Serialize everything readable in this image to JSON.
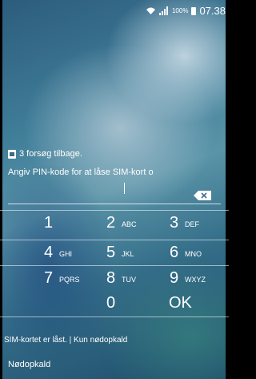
{
  "status_bar": {
    "battery": "100%",
    "time": "07.38",
    "icons": [
      "wifi-icon",
      "signal-icon",
      "battery-icon"
    ]
  },
  "pin_entry": {
    "attempts_text": "3 forsøg tilbage.",
    "prompt_text": "Angiv PIN-kode for at låse SIM-kort o",
    "icons": [
      "sim-card-icon",
      "backspace-icon"
    ]
  },
  "keypad": [
    {
      "digit": "1",
      "letters": ""
    },
    {
      "digit": "2",
      "letters": "ABC"
    },
    {
      "digit": "3",
      "letters": "DEF"
    },
    {
      "digit": "4",
      "letters": "GHI"
    },
    {
      "digit": "5",
      "letters": "JKL"
    },
    {
      "digit": "6",
      "letters": "MNO"
    },
    {
      "digit": "7",
      "letters": "PQRS"
    },
    {
      "digit": "8",
      "letters": "TUV"
    },
    {
      "digit": "9",
      "letters": "WXYZ"
    },
    {
      "digit": "0",
      "letters": ""
    },
    {
      "digit": "OK",
      "letters": ""
    }
  ],
  "footer": {
    "sim_status": "SIM-kortet er låst. | Kun nødopkald",
    "emergency_label": "Nødopkald"
  }
}
